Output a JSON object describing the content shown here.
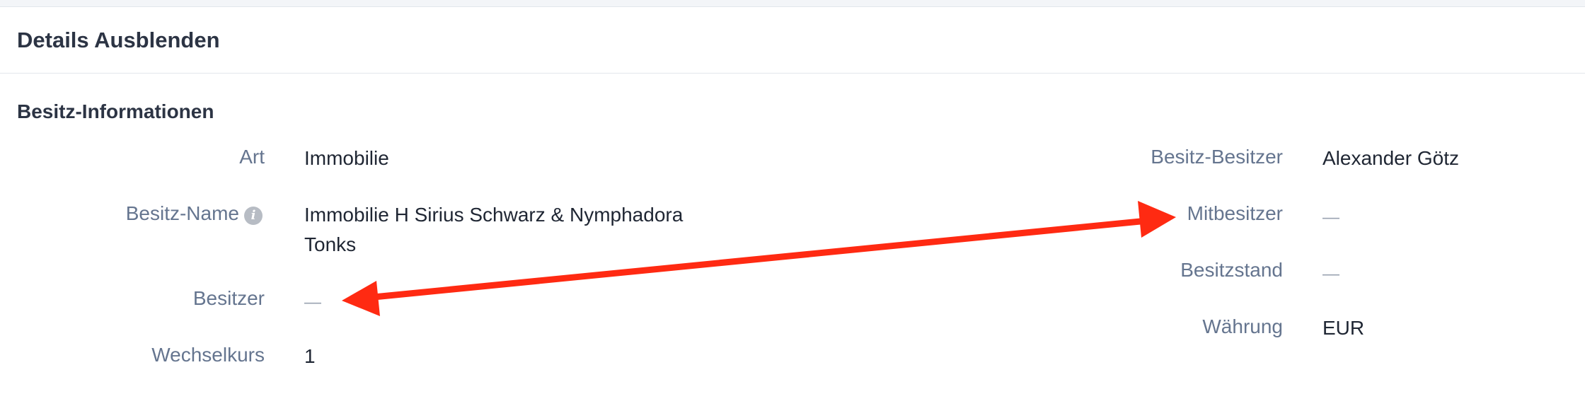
{
  "header": {
    "title": "Details Ausblenden"
  },
  "section": {
    "title": "Besitz-Informationen"
  },
  "fields_left": {
    "art": {
      "label": "Art",
      "value": "Immobilie"
    },
    "besitz_name": {
      "label": "Besitz-Name",
      "value": "Immobilie H Sirius Schwarz & Nymphadora Tonks",
      "info_icon_glyph": "i"
    },
    "besitzer": {
      "label": "Besitzer",
      "value": "—"
    },
    "wechselkurs": {
      "label": "Wechselkurs",
      "value": "1"
    }
  },
  "fields_right": {
    "besitz_besitzer": {
      "label": "Besitz-Besitzer",
      "value": "Alexander Götz"
    },
    "mitbesitzer": {
      "label": "Mitbesitzer",
      "value": "—"
    },
    "besitzstand": {
      "label": "Besitzstand",
      "value": "—"
    },
    "waehrung": {
      "label": "Währung",
      "value": "EUR"
    }
  },
  "colors": {
    "label": "#65758f",
    "value": "#1f2633",
    "heading": "#2c3444",
    "annotation_arrow": "#ff2a12"
  },
  "icons": {
    "info": "info-icon",
    "annotation": "double-headed-arrow-annotation"
  }
}
